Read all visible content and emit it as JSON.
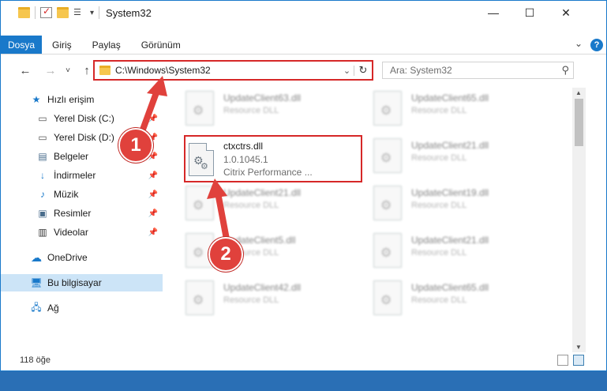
{
  "window": {
    "title": "System32",
    "controls": {
      "minimize": "—",
      "maximize": "☐",
      "close": "✕"
    }
  },
  "ribbon": {
    "tabs": [
      "Dosya",
      "Giriş",
      "Paylaş",
      "Görünüm"
    ],
    "help": "?"
  },
  "nav": {
    "back": "←",
    "forward": "→",
    "recent": "˅",
    "up": "↑",
    "address": "C:\\Windows\\System32",
    "search_placeholder": "Ara: System32"
  },
  "sidebar": {
    "items": [
      {
        "label": "Hızlı erişim",
        "icon": "star-icon",
        "pinned": false
      },
      {
        "label": "Yerel Disk (C:)",
        "icon": "drive-icon",
        "pinned": true
      },
      {
        "label": "Yerel Disk (D:)",
        "icon": "drive-icon",
        "pinned": true
      },
      {
        "label": "Belgeler",
        "icon": "documents-icon",
        "pinned": true
      },
      {
        "label": "İndirmeler",
        "icon": "download-icon",
        "pinned": true
      },
      {
        "label": "Müzik",
        "icon": "music-icon",
        "pinned": true
      },
      {
        "label": "Resimler",
        "icon": "pictures-icon",
        "pinned": true
      },
      {
        "label": "Videolar",
        "icon": "video-icon",
        "pinned": true
      },
      {
        "label": "OneDrive",
        "icon": "cloud-icon",
        "pinned": false
      },
      {
        "label": "Bu bilgisayar",
        "icon": "computer-icon",
        "pinned": false
      },
      {
        "label": "Ağ",
        "icon": "network-icon",
        "pinned": false
      }
    ]
  },
  "files": {
    "highlighted": {
      "name": "ctxctrs.dll",
      "version": "1.0.1045.1",
      "description": "Citrix Performance ..."
    },
    "background": [
      {
        "name": "UpdateClient63.dll",
        "desc": "Resource DLL"
      },
      {
        "name": "UpdateClient65.dll",
        "desc": "Resource DLL"
      },
      {
        "name": "UpdateClient21.dll",
        "desc": "Resource DLL"
      },
      {
        "name": "UpdateClient21.dll",
        "desc": "Resource DLL"
      },
      {
        "name": "UpdateClient19.dll",
        "desc": "Resource DLL"
      },
      {
        "name": "UpdateClient5.dll",
        "desc": "Resource DLL"
      },
      {
        "name": "UpdateClient21.dll",
        "desc": "Resource DLL"
      },
      {
        "name": "UpdateClient42.dll",
        "desc": "Resource DLL"
      },
      {
        "name": "UpdateClient65.dll",
        "desc": "Resource DLL"
      }
    ]
  },
  "status": {
    "count": "118 öğe"
  },
  "annotations": {
    "step1": "1",
    "step2": "2"
  },
  "colors": {
    "accent": "#1979ca",
    "highlight": "#d62828",
    "badge": "#e0413c"
  }
}
